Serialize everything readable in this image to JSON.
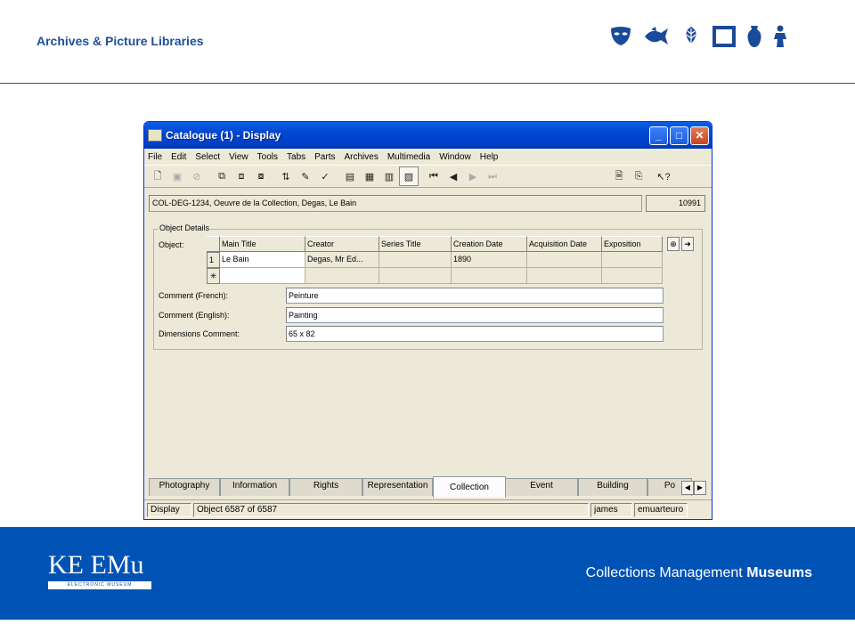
{
  "header": {
    "title": "Archives & Picture Libraries",
    "icons": [
      "mask-icon",
      "fish-icon",
      "leaf-icon",
      "frame-icon",
      "vase-icon",
      "figure-icon"
    ],
    "accent": "#1f4e9c"
  },
  "window": {
    "title": "Catalogue (1) - Display",
    "menu": [
      "File",
      "Edit",
      "Select",
      "View",
      "Tools",
      "Tabs",
      "Parts",
      "Archives",
      "Multimedia",
      "Window",
      "Help"
    ],
    "record_id": "COL-DEG-1234, Oeuvre de la Collection, Degas, Le Bain",
    "record_number": "10991"
  },
  "object_details": {
    "legend": "Object Details",
    "object_label": "Object:",
    "columns": [
      "Main Title",
      "Creator",
      "Series Title",
      "Creation Date",
      "Acquisition Date",
      "Exposition"
    ],
    "rows": [
      {
        "num": "1",
        "main_title": "Le Bain",
        "creator": "Degas, Mr Ed...",
        "series_title": "",
        "creation_date": "1890",
        "acquisition_date": "",
        "exposition": ""
      }
    ],
    "new_row_marker": "✳",
    "comment_fr_label": "Comment (French):",
    "comment_fr": "Peinture",
    "comment_en_label": "Comment (English):",
    "comment_en": "Painting",
    "dimensions_label": "Dimensions Comment:",
    "dimensions": "65 x 82"
  },
  "tabs": [
    "Photography",
    "Information",
    "Rights",
    "Representation",
    "Collection",
    "Event",
    "Building",
    "Po"
  ],
  "active_tab": "Collection",
  "status": {
    "mode": "Display",
    "position": "Object 6587 of 6587",
    "user": "james",
    "database": "emuarteuro"
  },
  "footer": {
    "logo": "KE EMu",
    "logo_sub": "ELECTRONIC MUSEUM",
    "tagline_regular": "Collections Management",
    "tagline_bold": "Museums",
    "background": "#0052b4"
  }
}
